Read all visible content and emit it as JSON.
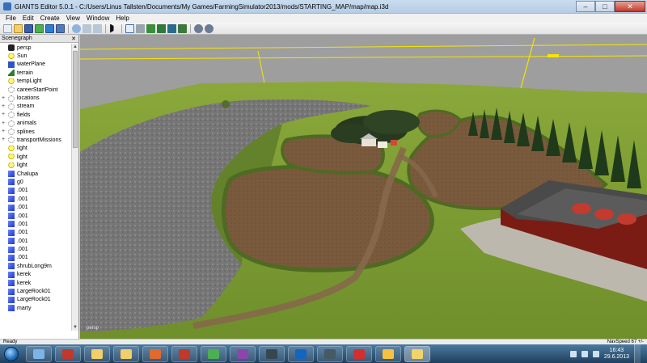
{
  "window": {
    "title": "GIANTS Editor 5.0.1 - C:/Users/Linus Tallsten/Documents/My Games/FarmingSimulator2013/mods/STARTING_MAP/map/map.i3d",
    "minimize": "–",
    "maximize": "□",
    "close": "✕"
  },
  "menu": [
    "File",
    "Edit",
    "Create",
    "View",
    "Window",
    "Help"
  ],
  "scenegraph": {
    "title": "Scenegraph",
    "close": "✕",
    "items": [
      {
        "label": "persp",
        "icon": "camera-icon",
        "expander": ""
      },
      {
        "label": "Sun",
        "icon": "light-icon",
        "expander": ""
      },
      {
        "label": "waterPlane",
        "icon": "water-icon",
        "expander": ""
      },
      {
        "label": "terrain",
        "icon": "terrain-icon",
        "expander": ""
      },
      {
        "label": "tempLight",
        "icon": "light-icon",
        "expander": ""
      },
      {
        "label": "careerStartPoint",
        "icon": "group-icon",
        "expander": ""
      },
      {
        "label": "locations",
        "icon": "group-icon",
        "expander": "+"
      },
      {
        "label": "stream",
        "icon": "group-icon",
        "expander": "+"
      },
      {
        "label": "fields",
        "icon": "group-icon",
        "expander": "+"
      },
      {
        "label": "animals",
        "icon": "group-icon",
        "expander": "+"
      },
      {
        "label": "splines",
        "icon": "group-icon",
        "expander": "+"
      },
      {
        "label": "transportMissions",
        "icon": "group-icon",
        "expander": "+"
      },
      {
        "label": "light",
        "icon": "light-icon",
        "expander": ""
      },
      {
        "label": "light",
        "icon": "light-icon",
        "expander": ""
      },
      {
        "label": "light",
        "icon": "light-icon",
        "expander": ""
      },
      {
        "label": "Chalupa",
        "icon": "cube-icon",
        "expander": ""
      },
      {
        "label": "g0",
        "icon": "cube-icon",
        "expander": ""
      },
      {
        "label": ".001",
        "icon": "cube-icon",
        "expander": ""
      },
      {
        "label": ".001",
        "icon": "cube-icon",
        "expander": ""
      },
      {
        "label": ".001",
        "icon": "cube-icon",
        "expander": ""
      },
      {
        "label": ".001",
        "icon": "cube-icon",
        "expander": ""
      },
      {
        "label": ".001",
        "icon": "cube-icon",
        "expander": ""
      },
      {
        "label": ".001",
        "icon": "cube-icon",
        "expander": ""
      },
      {
        "label": ".001",
        "icon": "cube-icon",
        "expander": ""
      },
      {
        "label": ".001",
        "icon": "cube-icon",
        "expander": ""
      },
      {
        "label": ".001",
        "icon": "cube-icon",
        "expander": ""
      },
      {
        "label": "shrubLong9m",
        "icon": "cube-icon",
        "expander": ""
      },
      {
        "label": "kerek",
        "icon": "cube-icon",
        "expander": ""
      },
      {
        "label": "kerek",
        "icon": "cube-icon",
        "expander": ""
      },
      {
        "label": "LargeRock01",
        "icon": "cube-icon",
        "expander": ""
      },
      {
        "label": "LargeRock01",
        "icon": "cube-icon",
        "expander": ""
      },
      {
        "label": "marty",
        "icon": "cube-icon",
        "expander": ""
      }
    ]
  },
  "viewport": {
    "camera_label": "persp"
  },
  "status": {
    "left": "Ready",
    "right": "NavSpeed 67 +/-"
  },
  "taskbar": {
    "apps": [
      "windows-explorer",
      "media-player",
      "folder",
      "file-manager",
      "paint",
      "tool",
      "image-viewer",
      "media",
      "terminal",
      "network",
      "game",
      "opera",
      "package",
      "giants-editor"
    ],
    "active_index": 13
  },
  "clock": {
    "time": "16:43",
    "date": "29.6.2013"
  },
  "colors": {
    "title_bar": "#c9dcef",
    "taskbar": "#2b5078",
    "tree_cube": "#1d36c9",
    "grass": "#7c9a32",
    "field": "#7b5a3c"
  }
}
